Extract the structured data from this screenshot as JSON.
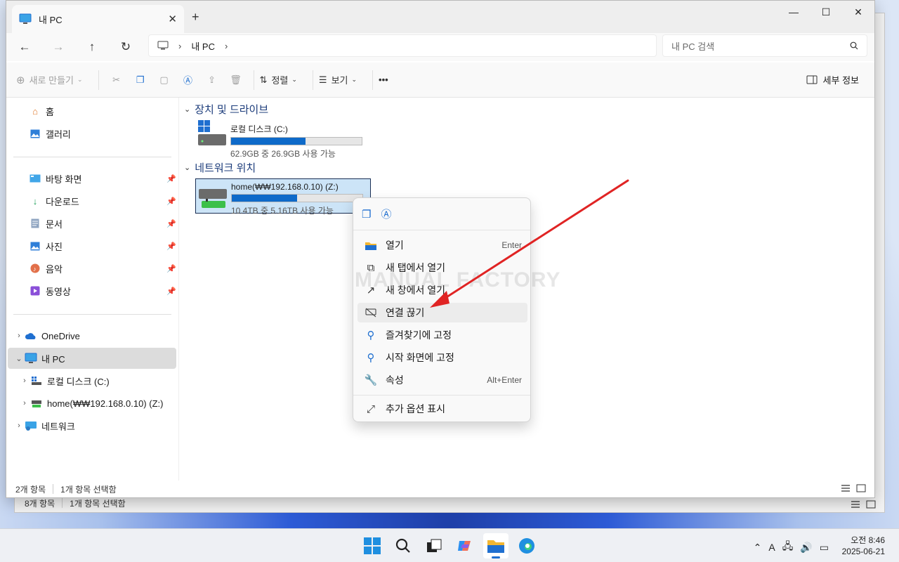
{
  "window": {
    "tab_title": "내 PC",
    "minimize": "—",
    "maximize": "☐",
    "close": "✕"
  },
  "nav": {
    "breadcrumb": [
      "내 PC"
    ],
    "search_placeholder": "내 PC 검색"
  },
  "toolbar": {
    "new_label": "새로 만들기",
    "sort_label": "정렬",
    "view_label": "보기",
    "more_label": "•••",
    "details_label": "세부 정보"
  },
  "sidebar": {
    "home": "홈",
    "gallery": "갤러리",
    "quick": [
      {
        "label": "바탕 화면"
      },
      {
        "label": "다운로드"
      },
      {
        "label": "문서"
      },
      {
        "label": "사진"
      },
      {
        "label": "음악"
      },
      {
        "label": "동영상"
      }
    ],
    "onedrive": "OneDrive",
    "mypc": "내 PC",
    "local_disk": "로컬 디스크 (C:)",
    "network_drive": "home(₩₩192.168.0.10) (Z:)",
    "network": "네트워크"
  },
  "content": {
    "devices_header": "장치 및 드라이브",
    "network_header": "네트워크 위치",
    "local": {
      "name": "로컬 디스크 (C:)",
      "space": "62.9GB 중 26.9GB 사용 가능",
      "used_fraction": 0.57
    },
    "net": {
      "name": "home(₩₩192.168.0.10) (Z:)",
      "space": "10.4TB 중 5.16TB 사용 가능",
      "used_fraction": 0.5
    }
  },
  "context_menu": {
    "items": [
      {
        "label": "열기",
        "shortcut": "Enter"
      },
      {
        "label": "새 탭에서 열기",
        "shortcut": ""
      },
      {
        "label": "새 창에서 열기",
        "shortcut": ""
      },
      {
        "label": "연결 끊기",
        "shortcut": ""
      },
      {
        "label": "즐겨찾기에 고정",
        "shortcut": ""
      },
      {
        "label": "시작 화면에 고정",
        "shortcut": ""
      },
      {
        "label": "속성",
        "shortcut": "Alt+Enter"
      },
      {
        "label": "추가 옵션 표시",
        "shortcut": ""
      }
    ]
  },
  "watermark": "MANUAL FACTORY",
  "status": {
    "count": "2개 항목",
    "selected": "1개 항목 선택함"
  },
  "back_status": {
    "count": "8개 항목",
    "selected": "1개 항목 선택함"
  },
  "taskbar": {
    "time": "오전 8:46",
    "date": "2025-06-21",
    "ime": "A"
  },
  "colors": {
    "accent": "#1f6fd0",
    "arrow": "#e02424",
    "bar_fill": "#0e6ac9"
  }
}
